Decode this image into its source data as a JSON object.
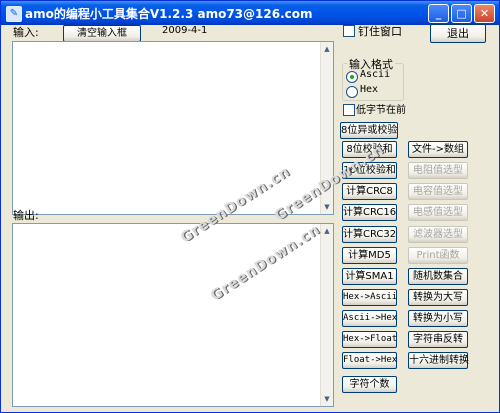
{
  "window": {
    "title": "amo的编程小工具集合V1.2.3 amo73@126.com",
    "icon": "app-icon"
  },
  "header": {
    "input_label": "输入:",
    "clear_button": "清空输入框",
    "date": "2009-4-1",
    "pin_window_label": "钉住窗口",
    "pin_window_checked": false,
    "exit_button": "退出"
  },
  "output_label": "输出:",
  "format_group": {
    "title": "输入格式",
    "options": [
      "Ascii",
      "Hex"
    ],
    "selected": "Ascii"
  },
  "low_byte_first": {
    "label": "低字节在前",
    "checked": false
  },
  "left_buttons": [
    {
      "label": "8位异或校验",
      "enabled": true
    },
    {
      "label": "8位校验和",
      "enabled": true
    },
    {
      "label": "16位校验和",
      "enabled": true
    },
    {
      "label": "计算CRC8",
      "enabled": true
    },
    {
      "label": "计算CRC16",
      "enabled": true
    },
    {
      "label": "计算CRC32",
      "enabled": true
    },
    {
      "label": "计算MD5",
      "enabled": true
    },
    {
      "label": "计算SMA1",
      "enabled": true
    },
    {
      "label": "Hex->Ascii",
      "enabled": true
    },
    {
      "label": "Ascii->Hex",
      "enabled": true
    },
    {
      "label": "Hex->Float",
      "enabled": true
    },
    {
      "label": "Float->Hex",
      "enabled": true
    },
    {
      "label": "字符个数",
      "enabled": true
    }
  ],
  "right_buttons": [
    {
      "label": "文件->数组",
      "enabled": true
    },
    {
      "label": "电阻值选型",
      "enabled": false
    },
    {
      "label": "电容值选型",
      "enabled": false
    },
    {
      "label": "电感值选型",
      "enabled": false
    },
    {
      "label": "滤波器选型",
      "enabled": false
    },
    {
      "label": "Print函数",
      "enabled": false
    },
    {
      "label": "随机数集合",
      "enabled": true
    },
    {
      "label": "转换为大写",
      "enabled": true
    },
    {
      "label": "转换为小写",
      "enabled": true
    },
    {
      "label": "字符串反转",
      "enabled": true
    },
    {
      "label": "十六进制转换",
      "enabled": true
    }
  ],
  "watermarks": [
    "GreenDown.cn",
    "GreenDown.cn",
    "GreenDown.cn"
  ]
}
